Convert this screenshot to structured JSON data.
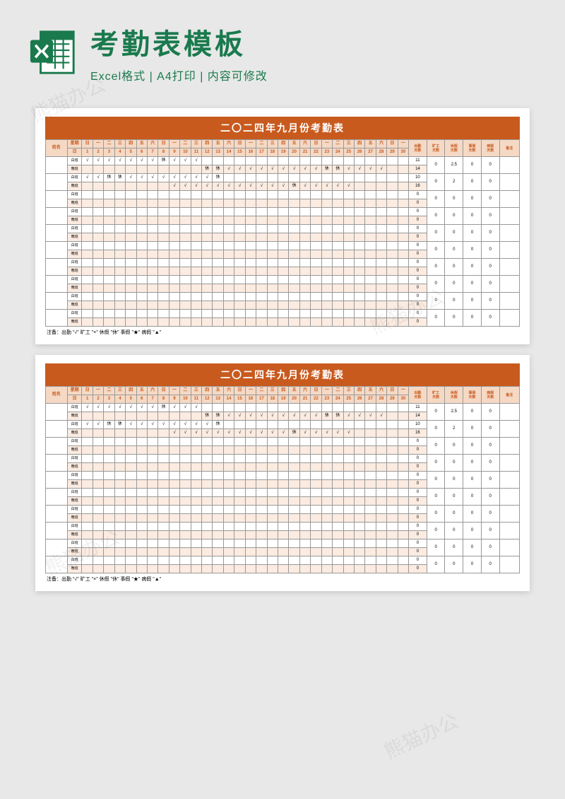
{
  "header": {
    "title": "考勤表模板",
    "subtitle": "Excel格式 | A4打印 | 内容可修改"
  },
  "watermark": "熊猫办公",
  "sheet": {
    "title": "二〇二四年九月份考勤表",
    "name_label": "姓名",
    "weekday_label": "星期",
    "day_label": "日",
    "shift_labels": [
      "白班",
      "晚班"
    ],
    "weekdays": [
      "日",
      "一",
      "二",
      "三",
      "四",
      "五",
      "六",
      "日",
      "一",
      "二",
      "三",
      "四",
      "五",
      "六",
      "日",
      "一",
      "二",
      "三",
      "四",
      "五",
      "六",
      "日",
      "一",
      "二",
      "三",
      "四",
      "五",
      "六",
      "日",
      "一"
    ],
    "days": [
      "1",
      "2",
      "3",
      "4",
      "5",
      "6",
      "7",
      "8",
      "9",
      "10",
      "11",
      "12",
      "13",
      "14",
      "15",
      "16",
      "17",
      "18",
      "19",
      "20",
      "21",
      "22",
      "23",
      "24",
      "25",
      "26",
      "27",
      "28",
      "29",
      "30"
    ],
    "summary_headers": [
      "出勤\n天数",
      "旷工\n天数",
      "休假\n天数",
      "事假\n天数",
      "病假\n天数",
      "备注"
    ],
    "rows": [
      {
        "shifts": [
          {
            "marks": [
              "√",
              "√",
              "√",
              "√",
              "√",
              "√",
              "√",
              "休",
              "√",
              "√",
              "√",
              "",
              "",
              "",
              "",
              "",
              "",
              "",
              "",
              "",
              "",
              "",
              "",
              "",
              "",
              "",
              "",
              "",
              "",
              ""
            ],
            "sum": "11"
          },
          {
            "marks": [
              "",
              "",
              "",
              "",
              "",
              "",
              "",
              "",
              "",
              "",
              "",
              "休",
              "休",
              "√",
              "√",
              "√",
              "√",
              "√",
              "√",
              "√",
              "√",
              "√",
              "休",
              "休",
              "√",
              "√",
              "√",
              "√",
              "",
              ""
            ],
            "sum": "14"
          }
        ],
        "sums": [
          "0",
          "2.5",
          "0",
          "0",
          ""
        ]
      },
      {
        "shifts": [
          {
            "marks": [
              "√",
              "√",
              "休",
              "休",
              "√",
              "√",
              "√",
              "√",
              "√",
              "√",
              "√",
              "√",
              "休",
              "",
              "",
              "",
              "",
              "",
              "",
              "",
              "",
              "",
              "",
              "",
              "",
              "",
              "",
              "",
              "",
              ""
            ],
            "sum": "10"
          },
          {
            "marks": [
              "",
              "",
              "",
              "",
              "",
              "",
              "",
              "",
              "√",
              "√",
              "√",
              "√",
              "√",
              "√",
              "√",
              "√",
              "√",
              "√",
              "√",
              "休",
              "√",
              "√",
              "√",
              "√",
              "√",
              "",
              "",
              "",
              "",
              ""
            ],
            "sum": "16"
          }
        ],
        "sums": [
          "0",
          "2",
          "0",
          "0",
          ""
        ]
      },
      {
        "shifts": [
          {
            "marks": [],
            "sum": "0"
          },
          {
            "marks": [],
            "sum": "0"
          }
        ],
        "sums": [
          "0",
          "0",
          "0",
          "0",
          ""
        ]
      },
      {
        "shifts": [
          {
            "marks": [],
            "sum": "0"
          },
          {
            "marks": [],
            "sum": "0"
          }
        ],
        "sums": [
          "0",
          "0",
          "0",
          "0",
          ""
        ]
      },
      {
        "shifts": [
          {
            "marks": [],
            "sum": "0"
          },
          {
            "marks": [],
            "sum": "0"
          }
        ],
        "sums": [
          "0",
          "0",
          "0",
          "0",
          ""
        ]
      },
      {
        "shifts": [
          {
            "marks": [],
            "sum": "0"
          },
          {
            "marks": [],
            "sum": "0"
          }
        ],
        "sums": [
          "0",
          "0",
          "0",
          "0",
          ""
        ]
      },
      {
        "shifts": [
          {
            "marks": [],
            "sum": "0"
          },
          {
            "marks": [],
            "sum": "0"
          }
        ],
        "sums": [
          "0",
          "0",
          "0",
          "0",
          ""
        ]
      },
      {
        "shifts": [
          {
            "marks": [],
            "sum": "0"
          },
          {
            "marks": [],
            "sum": "0"
          }
        ],
        "sums": [
          "0",
          "0",
          "0",
          "0",
          ""
        ]
      },
      {
        "shifts": [
          {
            "marks": [],
            "sum": "0"
          },
          {
            "marks": [],
            "sum": "0"
          }
        ],
        "sums": [
          "0",
          "0",
          "0",
          "0",
          ""
        ]
      },
      {
        "shifts": [
          {
            "marks": [],
            "sum": "0"
          },
          {
            "marks": [],
            "sum": "0"
          }
        ],
        "sums": [
          "0",
          "0",
          "0",
          "0",
          ""
        ]
      }
    ],
    "footnote": "注备：出勤 \"√\" 旷工 \"×\" 休假 \"休\" 事假 \"★\" 病假 \"▲\""
  },
  "chart_data": {
    "type": "table",
    "title": "二〇二四年九月份考勤表",
    "columns_days": 30,
    "summary_columns": [
      "出勤天数",
      "旷工天数",
      "休假天数",
      "事假天数",
      "病假天数",
      "备注"
    ],
    "employees": [
      {
        "出勤": [
          11,
          14
        ],
        "旷工": 0,
        "休假": 2.5,
        "事假": 0,
        "病假": 0
      },
      {
        "出勤": [
          10,
          16
        ],
        "旷工": 0,
        "休假": 2,
        "事假": 0,
        "病假": 0
      },
      {
        "出勤": [
          0,
          0
        ],
        "旷工": 0,
        "休假": 0,
        "事假": 0,
        "病假": 0
      },
      {
        "出勤": [
          0,
          0
        ],
        "旷工": 0,
        "休假": 0,
        "事假": 0,
        "病假": 0
      },
      {
        "出勤": [
          0,
          0
        ],
        "旷工": 0,
        "休假": 0,
        "事假": 0,
        "病假": 0
      },
      {
        "出勤": [
          0,
          0
        ],
        "旷工": 0,
        "休假": 0,
        "事假": 0,
        "病假": 0
      },
      {
        "出勤": [
          0,
          0
        ],
        "旷工": 0,
        "休假": 0,
        "事假": 0,
        "病假": 0
      },
      {
        "出勤": [
          0,
          0
        ],
        "旷工": 0,
        "休假": 0,
        "事假": 0,
        "病假": 0
      },
      {
        "出勤": [
          0,
          0
        ],
        "旷工": 0,
        "休假": 0,
        "事假": 0,
        "病假": 0
      },
      {
        "出勤": [
          0,
          0
        ],
        "旷工": 0,
        "休假": 0,
        "事假": 0,
        "病假": 0
      }
    ],
    "legend": {
      "√": "出勤",
      "×": "旷工",
      "休": "休假",
      "★": "事假",
      "▲": "病假"
    }
  }
}
